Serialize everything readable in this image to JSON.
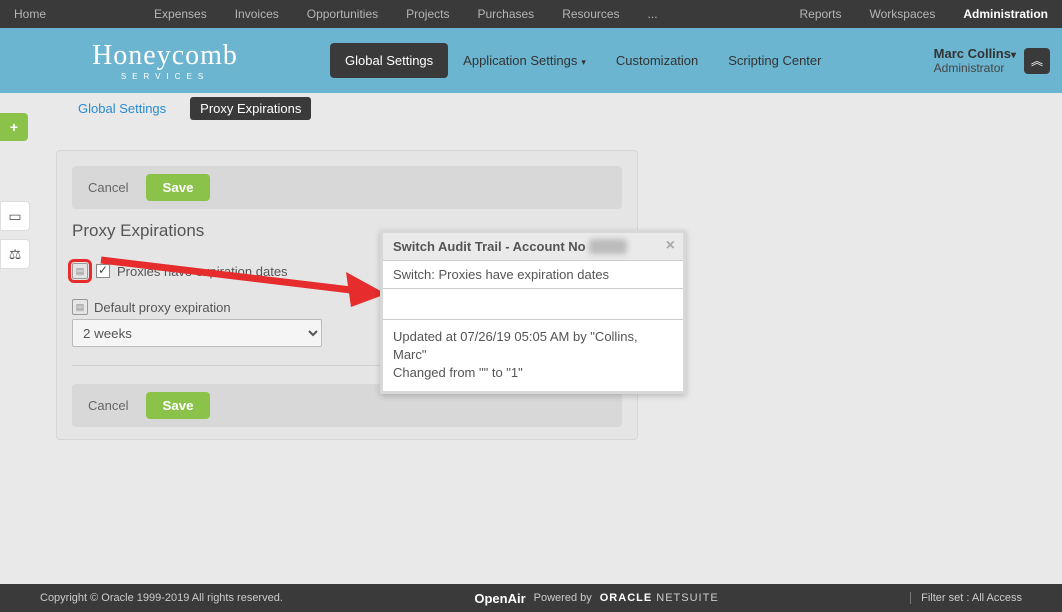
{
  "topnav": {
    "items": [
      "Home",
      "Expenses",
      "Invoices",
      "Opportunities",
      "Projects",
      "Purchases",
      "Resources",
      "..."
    ],
    "right": [
      "Reports",
      "Workspaces",
      "Administration"
    ],
    "active_right": "Administration"
  },
  "logo": {
    "main": "Honeycomb",
    "sub": "SERVICES"
  },
  "hnav": {
    "items": [
      {
        "label": "Global Settings",
        "active": true
      },
      {
        "label": "Application Settings",
        "caret": true
      },
      {
        "label": "Customization"
      },
      {
        "label": "Scripting Center"
      }
    ]
  },
  "user": {
    "name": "Marc Collins",
    "role": "Administrator"
  },
  "breadcrumb": {
    "root": "Global Settings",
    "current": "Proxy Expirations"
  },
  "card": {
    "title": "Proxy Expirations",
    "cancel": "Cancel",
    "save": "Save",
    "checkbox_label": "Proxies have expiration dates",
    "checkbox_checked": true,
    "select_label": "Default proxy expiration",
    "select_value": "2 weeks"
  },
  "popup": {
    "title_prefix": "Switch Audit Trail - Account No",
    "switch_label": "Switch: Proxies have expiration dates",
    "body_line1": "Updated at 07/26/19 05:05 AM by \"Collins, Marc\"",
    "body_line2": "Changed from \"\" to \"1\""
  },
  "footer": {
    "copyright": "Copyright © Oracle 1999-2019 All rights reserved.",
    "powered": "Powered by",
    "openair": "OpenAir",
    "oracle": "ORACLE",
    "netsuite": "NETSUITE",
    "filter": "Filter set : All Access"
  }
}
